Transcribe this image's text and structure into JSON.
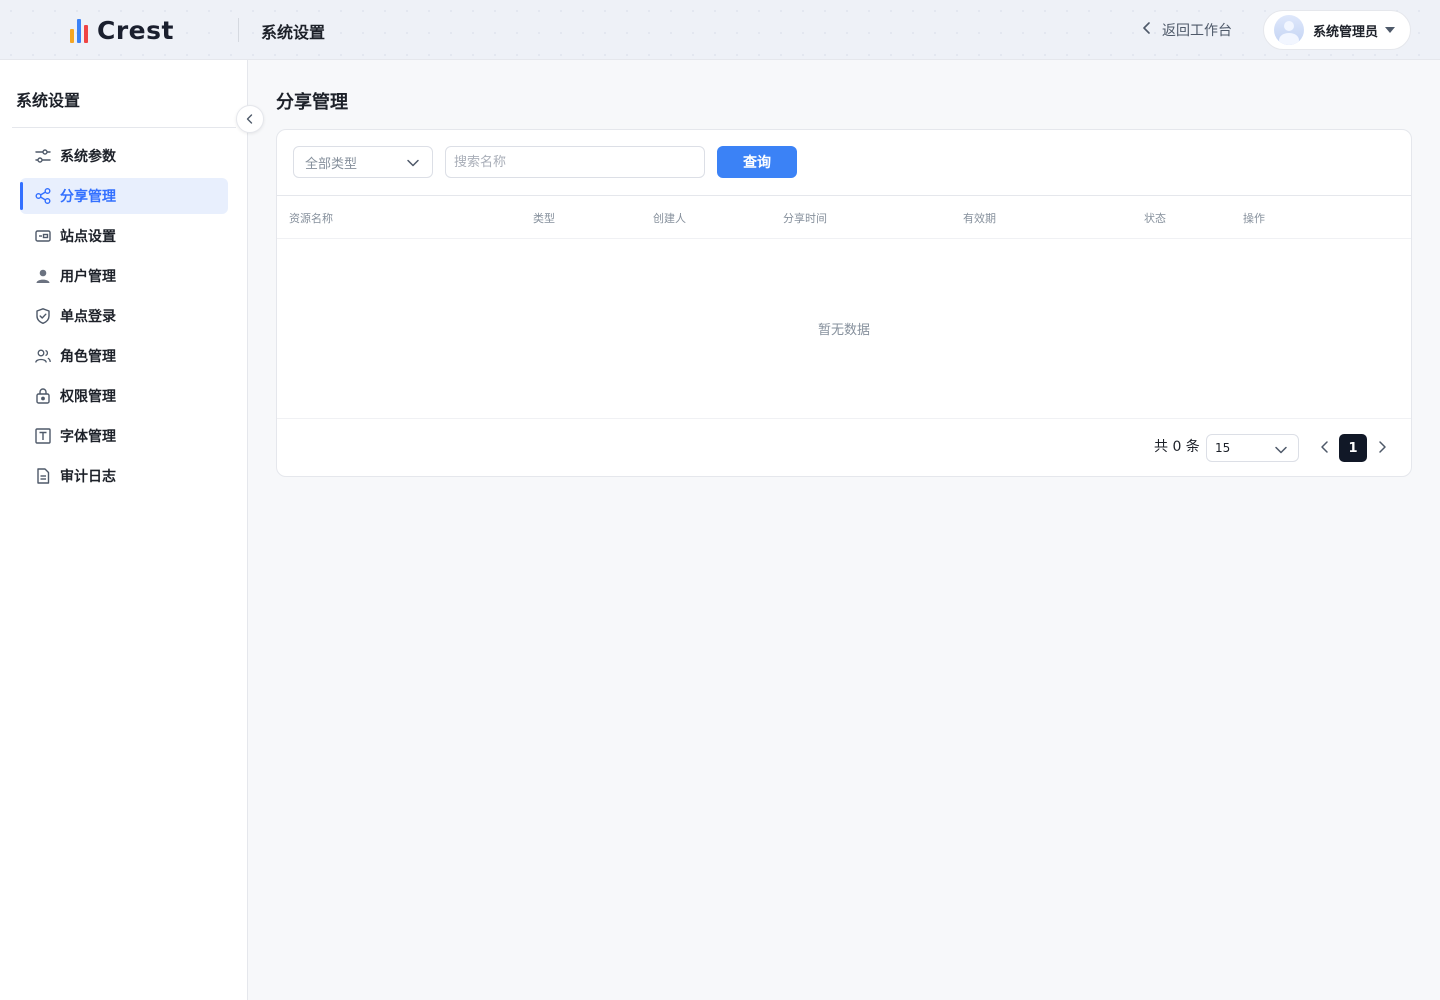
{
  "header": {
    "brand": "Crest",
    "brand_colors": [
      "#f5a623",
      "#3b82f6",
      "#ef4444"
    ],
    "title": "系统设置",
    "back_link": "返回工作台",
    "user_name": "系统管理员"
  },
  "sidebar": {
    "title": "系统设置",
    "items": [
      {
        "label": "系统参数",
        "icon": "sliders-icon",
        "active": false
      },
      {
        "label": "分享管理",
        "icon": "share-icon",
        "active": true
      },
      {
        "label": "站点设置",
        "icon": "site-card-icon",
        "active": false
      },
      {
        "label": "用户管理",
        "icon": "user-icon",
        "active": false
      },
      {
        "label": "单点登录",
        "icon": "shield-check-icon",
        "active": false
      },
      {
        "label": "角色管理",
        "icon": "users-icon",
        "active": false
      },
      {
        "label": "权限管理",
        "icon": "lock-bag-icon",
        "active": false
      },
      {
        "label": "字体管理",
        "icon": "font-t-icon",
        "active": false
      },
      {
        "label": "审计日志",
        "icon": "document-icon",
        "active": false
      }
    ]
  },
  "main": {
    "page_title": "分享管理",
    "filter": {
      "type_select": "全部类型",
      "search_placeholder": "搜索名称",
      "search_value": "",
      "query_button": "查询"
    },
    "table": {
      "columns": [
        "资源名称",
        "类型",
        "创建人",
        "分享时间",
        "有效期",
        "状态",
        "操作"
      ],
      "rows": [],
      "empty_text": "暂无数据"
    },
    "pagination": {
      "total_text": "共 0 条",
      "page_size": "15",
      "current_page": "1"
    }
  },
  "colors": {
    "accent": "#3370ff",
    "primary_button": "#3b82f6",
    "active_page": "#111827"
  }
}
